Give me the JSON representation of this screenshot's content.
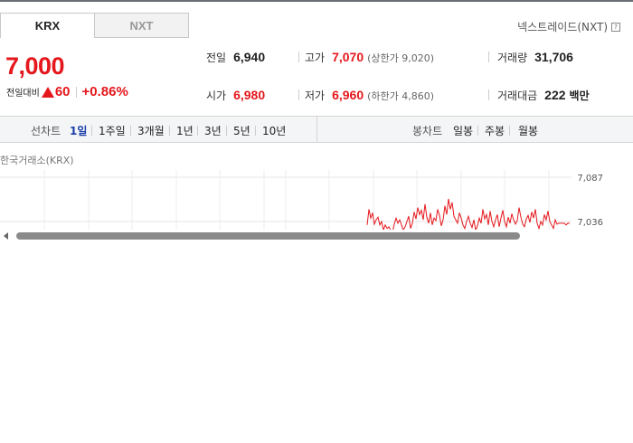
{
  "tabs": [
    {
      "label": "KRX",
      "active": true
    },
    {
      "label": "NXT",
      "active": false
    }
  ],
  "nxt_link": {
    "label": "넥스트레이드(NXT)",
    "help_icon": "help-icon"
  },
  "price": {
    "current": "7,000",
    "change_label": "전일대비",
    "change_icon": "triangle-up-icon",
    "change": "60",
    "rate": "+0.86%"
  },
  "summary": {
    "prev_close": {
      "label": "전일",
      "value": "6,940"
    },
    "high": {
      "label": "고가",
      "value": "7,070",
      "sub": "(상한가 9,020)"
    },
    "volume": {
      "label": "거래량",
      "value": "31,706"
    },
    "open": {
      "label": "시가",
      "value": "6,980"
    },
    "low": {
      "label": "저가",
      "value": "6,960",
      "sub": "(하한가 4,860)"
    },
    "trade_value": {
      "label": "거래대금",
      "value": "222",
      "unit": "백만"
    }
  },
  "line_chart_bar": {
    "label": "선차트",
    "periods": [
      "1일",
      "1주일",
      "3개월",
      "1년",
      "3년",
      "5년",
      "10년"
    ],
    "active": "1일"
  },
  "candle_chart_bar": {
    "label": "봉차트",
    "periods": [
      "일봉",
      "주봉",
      "월봉"
    ]
  },
  "exchange_label": "한국거래소(KRX)",
  "chart_data": {
    "type": "line",
    "y_tick_labels": [
      "7,087",
      "7,036"
    ],
    "y_ticks": [
      7087,
      7036
    ],
    "ylim": [
      7020,
      7087
    ],
    "grid": true,
    "series_color": "#e5171c",
    "x": [
      0,
      1,
      2,
      3,
      4,
      5,
      6,
      7,
      8,
      9,
      10,
      11,
      12,
      13,
      14,
      15,
      16,
      17,
      18,
      19,
      20,
      21,
      22,
      23,
      24,
      25,
      26,
      27,
      28,
      29,
      30,
      31,
      32,
      33,
      34,
      35,
      36,
      37,
      38,
      39,
      40,
      41,
      42,
      43,
      44,
      45,
      46,
      47,
      48,
      49,
      50,
      51,
      52,
      53,
      54,
      55,
      56,
      57,
      58,
      59,
      60,
      61,
      62,
      63,
      64,
      65,
      66,
      67,
      68,
      69,
      70,
      71,
      72,
      73,
      74,
      75,
      76,
      77,
      78,
      79,
      80,
      81,
      82,
      83,
      84,
      85,
      86,
      87,
      88,
      89,
      90,
      91,
      92,
      93,
      94,
      95,
      96,
      97,
      98,
      99,
      100,
      101,
      102,
      103,
      104,
      105,
      106,
      107,
      108,
      109,
      110,
      111,
      112
    ],
    "values": [
      7032,
      7050,
      7040,
      7046,
      7033,
      7038,
      7041,
      7032,
      7036,
      7026,
      7032,
      7028,
      7030,
      7026,
      7024,
      7033,
      7040,
      7034,
      7038,
      7032,
      7026,
      7030,
      7036,
      7042,
      7028,
      7034,
      7047,
      7039,
      7052,
      7044,
      7049,
      7038,
      7056,
      7041,
      7034,
      7046,
      7032,
      7040,
      7037,
      7050,
      7043,
      7031,
      7038,
      7054,
      7044,
      7062,
      7050,
      7058,
      7042,
      7038,
      7034,
      7046,
      7040,
      7032,
      7028,
      7036,
      7042,
      7034,
      7029,
      7038,
      7026,
      7031,
      7040,
      7034,
      7050,
      7039,
      7044,
      7032,
      7048,
      7036,
      7030,
      7038,
      7044,
      7030,
      7040,
      7049,
      7036,
      7030,
      7041,
      7034,
      7045,
      7038,
      7033,
      7037,
      7052,
      7041,
      7033,
      7030,
      7039,
      7043,
      7035,
      7047,
      7040,
      7050,
      7034,
      7028,
      7036,
      7032,
      7044,
      7038,
      7048,
      7036,
      7032,
      7028,
      7038,
      7033,
      7034,
      7034,
      7034,
      7034,
      7032,
      7034,
      7034
    ]
  }
}
